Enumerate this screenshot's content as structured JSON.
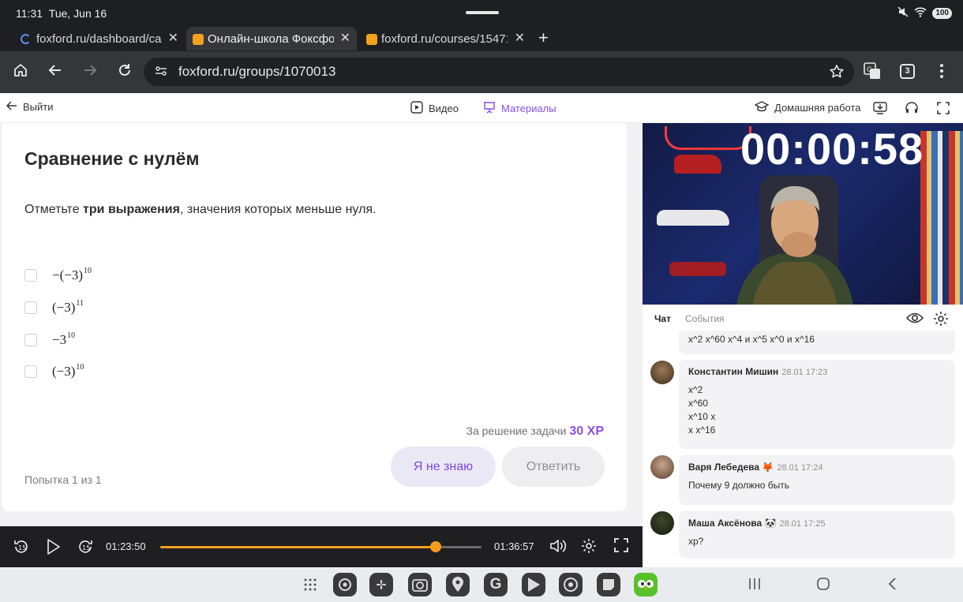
{
  "status": {
    "time": "11:31",
    "date": "Tue, Jun 16",
    "battery": "100"
  },
  "tabs": [
    {
      "title": "foxford.ru/dashboard/ca"
    },
    {
      "title": "Онлайн-школа Фоксфор"
    },
    {
      "title": "foxford.ru/courses/15471"
    }
  ],
  "address": {
    "url": "foxford.ru/groups/1070013"
  },
  "toolbar": {
    "exit_label": "Выйти",
    "video_label": "Видео",
    "materials_label": "Материалы",
    "homework_label": "Домашняя работа",
    "tab_count": "3"
  },
  "task": {
    "title": "Сравнение с нулём",
    "prompt_pre": "Отметьте ",
    "prompt_bold": "три выражения",
    "prompt_post": ", значения которых меньше нуля.",
    "options": [
      {
        "base": "−(−3)",
        "exp": "10"
      },
      {
        "base": "(−3)",
        "exp": "11"
      },
      {
        "base": "−3",
        "exp": "10"
      },
      {
        "base": "(−3)",
        "exp": "10"
      }
    ],
    "reward_text": "За решение задачи",
    "reward_xp": "30 XP",
    "dont_know_label": "Я не знаю",
    "submit_label": "Ответить",
    "attempt": "Попытка 1 из 1"
  },
  "player": {
    "current": "01:23:50",
    "duration": "01:36:57",
    "progress": 0.857,
    "skip_seconds": "15"
  },
  "video": {
    "timer": "00:00:58"
  },
  "chat": {
    "tab_chat": "Чат",
    "tab_events": "События",
    "partial_line": "x^2   x^60   x^4  и x^5        x^0  и  x^16",
    "messages": [
      {
        "author": "Константин Мишин",
        "time": "28.01 17:23",
        "lines": [
          "x^2",
          "x^60",
          "x^10 x",
          "x      x^16"
        ]
      },
      {
        "author": "Варя Лебедева",
        "emoji": "🦊",
        "time": "28.01 17:24",
        "lines": [
          "Почему 9 должно быть"
        ]
      },
      {
        "author": "Маша Аксёнова",
        "emoji": "🐼",
        "time": "28.01 17:25",
        "lines": [
          "xp?"
        ]
      }
    ]
  },
  "colors": {
    "accent": "#8a4fe8",
    "progress": "#f29d1d",
    "dark": "#1f1f22"
  }
}
